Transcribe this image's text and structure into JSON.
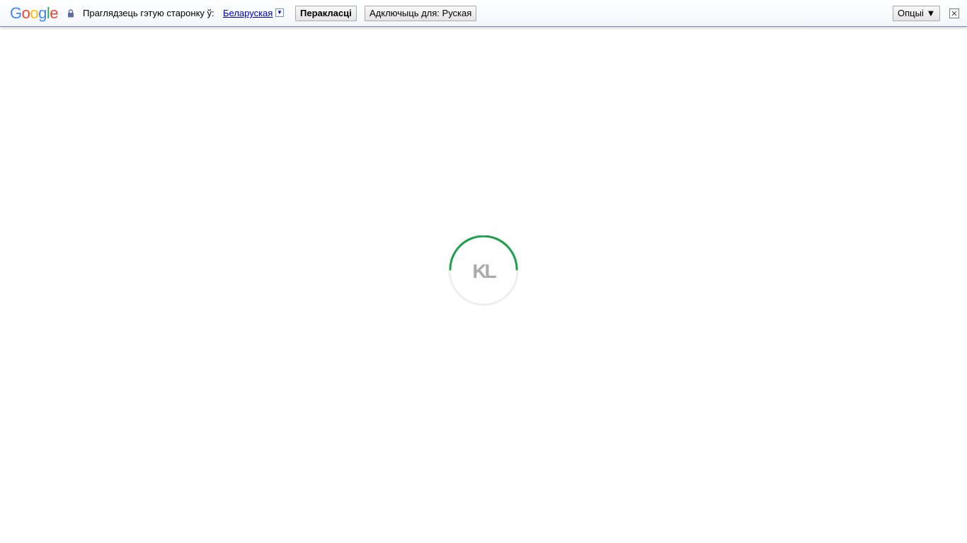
{
  "translate_bar": {
    "logo": {
      "letters": [
        "G",
        "o",
        "o",
        "g",
        "l",
        "e"
      ],
      "colors": [
        "#4285f4",
        "#ea4335",
        "#fbbc05",
        "#4285f4",
        "#34a853",
        "#ea4335"
      ]
    },
    "prompt": "Праглядзець гэтую старонку ў:",
    "language": "Беларуская",
    "dropdown_glyph": "▼",
    "translate_label": "Перакласці",
    "turn_off_label": "Адключыць для: Руская",
    "options_label": "Опцыі ▼"
  },
  "loader": {
    "logo_text": "KL",
    "ring_color": "#1ea04a",
    "track_color": "#eeeeee",
    "text_color": "#aaaaaa"
  }
}
